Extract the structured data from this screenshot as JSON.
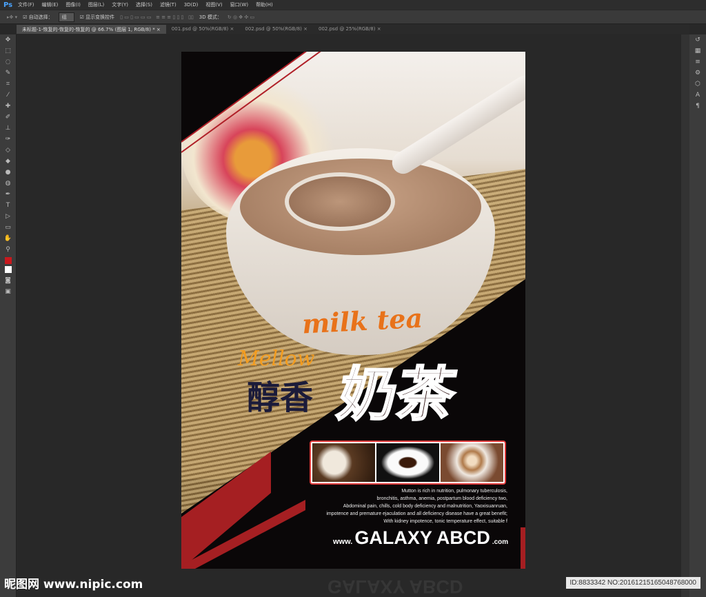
{
  "app": {
    "logo": "Ps",
    "menu": [
      "文件(F)",
      "编辑(E)",
      "图像(I)",
      "图层(L)",
      "文字(Y)",
      "选择(S)",
      "滤镜(T)",
      "3D(D)",
      "视图(V)",
      "窗口(W)",
      "帮助(H)"
    ]
  },
  "options": {
    "auto_select_label": "自动选择：",
    "auto_select_value": "组",
    "show_transform": "显示变换控件",
    "mode_3d": "3D 模式："
  },
  "tabs": [
    "未标题-1-恢复的-恢复的-恢复的 @ 66.7% (图层 1, RGB/8) *",
    "001.psd @ 50%(RGB/8)",
    "002.psd @ 50%(RGB/8)",
    "002.psd @ 25%(RGB/8)"
  ],
  "colors": {
    "foreground": "#c8191e",
    "background": "#ffffff"
  },
  "poster": {
    "milk_tea": "milk tea",
    "mellow": "Mellow",
    "cn_small": "醇香",
    "cn_big": "奶茶",
    "description": [
      "Mutton is rich in nutrition, pulmonary tuberculosis,",
      "bronchitis, asthma, anemia, postpartum blood deficiency two,",
      "Abdominal pain, chills, cold body deficiency and malnutrition, Yaoxisuanruan,",
      "impotence and premature ejaculation and all deficiency disease have a great benefit;",
      "With kidney impotence, tonic temperature effect, suitable f"
    ],
    "web_prefix": "www.",
    "web_name": "GALAXY ABCD",
    "web_suffix": ".com"
  },
  "watermark": {
    "site": "昵图网 www.nipic.com",
    "id": "ID:8833342 NO:20161215165048768000"
  }
}
